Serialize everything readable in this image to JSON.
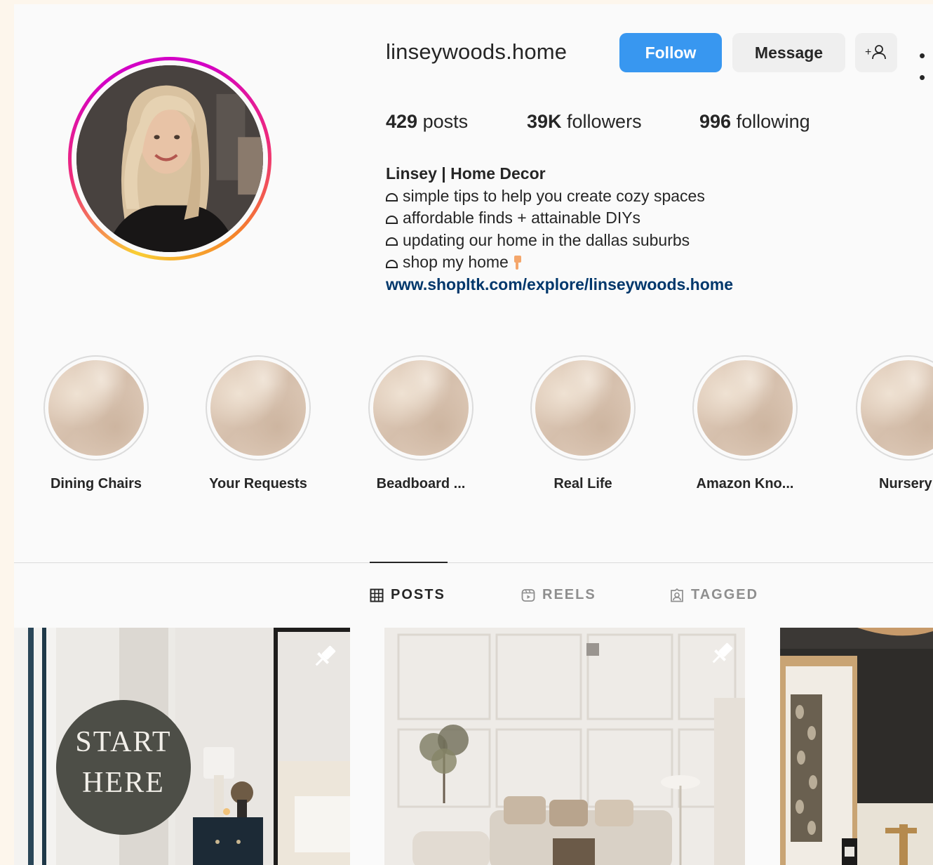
{
  "profile": {
    "username": "linseywoods.home",
    "follow_label": "Follow",
    "message_label": "Message",
    "add_user_label": "+",
    "more_label": "• •"
  },
  "stats": {
    "posts_count": "429",
    "posts_label": " posts",
    "followers_count": "39K",
    "followers_label": " followers",
    "following_count": "996",
    "following_label": " following"
  },
  "bio": {
    "name": "Linsey | Home Decor",
    "lines": [
      "simple tips to help you create cozy spaces",
      "affordable finds + attainable DIYs",
      "updating our home in the dallas suburbs",
      "shop my home"
    ],
    "link": "www.shopltk.com/explore/linseywoods.home"
  },
  "highlights": [
    {
      "label": "Dining Chairs"
    },
    {
      "label": "Your Requests"
    },
    {
      "label": "Beadboard ..."
    },
    {
      "label": "Real Life"
    },
    {
      "label": "Amazon Kno..."
    },
    {
      "label": "Nursery"
    }
  ],
  "tabs": [
    {
      "label": "POSTS",
      "icon": "grid-icon",
      "active": true
    },
    {
      "label": "REELS",
      "icon": "reels-icon",
      "active": false
    },
    {
      "label": "TAGGED",
      "icon": "tagged-icon",
      "active": false
    }
  ],
  "posts": [
    {
      "overlay_line1": "START",
      "overlay_line2": "HERE",
      "pinned": true
    },
    {
      "pinned": true
    },
    {
      "pinned": false
    }
  ],
  "colors": {
    "follow_button": "#3897f0",
    "link": "#00376b",
    "background": "#fafafa"
  }
}
